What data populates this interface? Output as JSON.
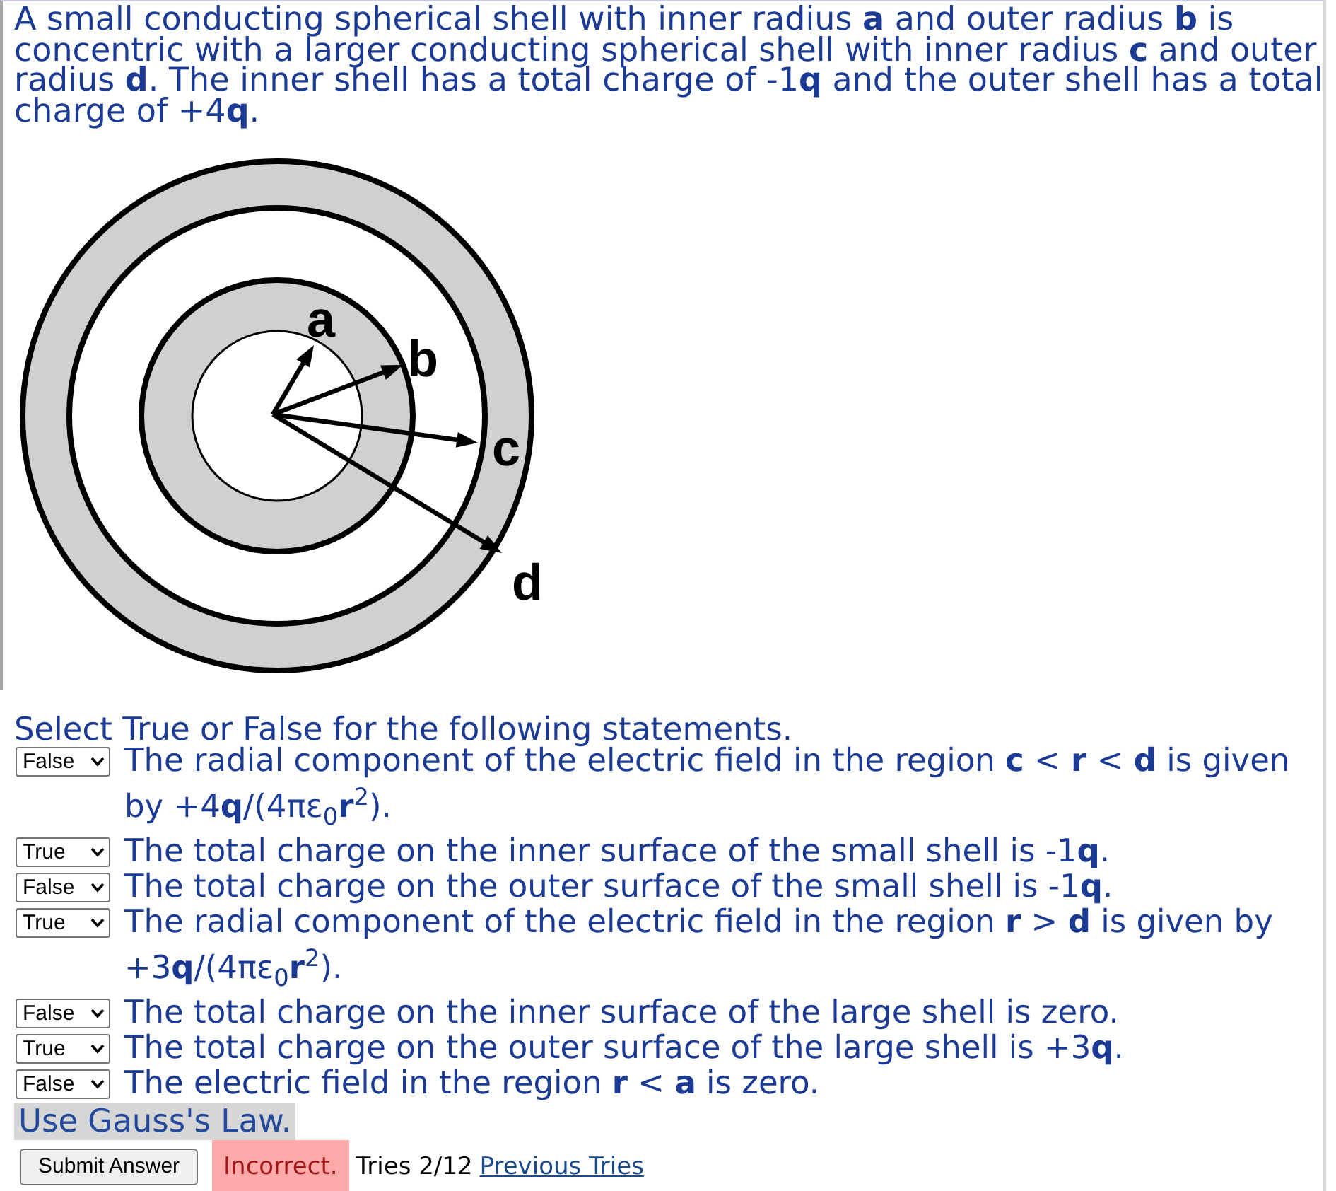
{
  "problem": {
    "text": "A small conducting spherical shell with inner radius **a** and outer radius **b** is concentric with a larger conducting spherical shell with inner radius **c** and outer radius **d**. The inner shell has a total charge of -1**q** and the outer shell has a total charge of +4**q**."
  },
  "diagram": {
    "labels": [
      "a",
      "b",
      "c",
      "d"
    ]
  },
  "instructions": "Select True or False for the following statements.",
  "statements": [
    {
      "answer": "False",
      "text": "The radial component of the electric field in the region **c** < **r** < **d** is given by +4**q**/(4πε$_{0}$**r**$^{2}$)."
    },
    {
      "answer": "True",
      "text": "The total charge on the inner surface of the small shell is -1**q**."
    },
    {
      "answer": "False",
      "text": "The total charge on the outer surface of the small shell is -1**q**."
    },
    {
      "answer": "True",
      "text": "The radial component of the electric field in the region **r** > **d** is given by +3**q**/(4πε$_{0}$**r**$^{2}$)."
    },
    {
      "answer": "False",
      "text": "The total charge on the inner surface of the large shell is zero."
    },
    {
      "answer": "True",
      "text": "The total charge on the outer surface of the large shell is +3**q**."
    },
    {
      "answer": "False",
      "text": "The electric field in the region **r** < **a** is zero."
    }
  ],
  "hint": "Use Gauss's Law.",
  "submit_button": "Submit Answer",
  "status": {
    "result": "Incorrect.",
    "tries": "Tries 2/12",
    "link": "Previous Tries"
  }
}
